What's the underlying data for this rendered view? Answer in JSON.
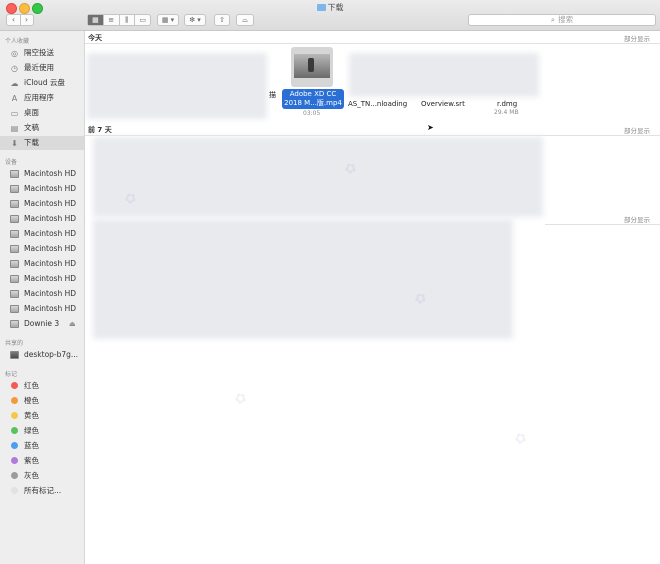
{
  "window": {
    "title": "下载"
  },
  "toolbar": {
    "back": "‹",
    "forward": "›",
    "view_buttons": [
      "▦",
      "≡",
      "⫼",
      "▭"
    ],
    "arrange": "▦ ▾",
    "action": "✻ ▾",
    "share": "⇧",
    "tag": "⌓",
    "search_placeholder": "搜索"
  },
  "sidebar": {
    "favorites_header": "个人收藏",
    "favorites": [
      {
        "label": "隔空投送",
        "icon": "airdrop-icon",
        "glyph": "◎"
      },
      {
        "label": "最近使用",
        "icon": "recents-icon",
        "glyph": "◷"
      },
      {
        "label": "iCloud 云盘",
        "icon": "cloud-icon",
        "glyph": "☁"
      },
      {
        "label": "应用程序",
        "icon": "applications-icon",
        "glyph": "A"
      },
      {
        "label": "桌面",
        "icon": "desktop-icon",
        "glyph": "▭"
      },
      {
        "label": "文稿",
        "icon": "documents-icon",
        "glyph": "▤"
      },
      {
        "label": "下载",
        "icon": "downloads-icon",
        "glyph": "⬇"
      }
    ],
    "devices_header": "设备",
    "devices": [
      {
        "label": "Macintosh HD"
      },
      {
        "label": "Macintosh HD"
      },
      {
        "label": "Macintosh HD"
      },
      {
        "label": "Macintosh HD"
      },
      {
        "label": "Macintosh HD"
      },
      {
        "label": "Macintosh HD"
      },
      {
        "label": "Macintosh HD"
      },
      {
        "label": "Macintosh HD"
      },
      {
        "label": "Macintosh HD"
      },
      {
        "label": "Macintosh HD"
      },
      {
        "label": "Downie 3"
      }
    ],
    "eject_glyph": "⏏",
    "shared_header": "共享的",
    "shared": [
      {
        "label": "desktop-b7g..."
      }
    ],
    "tags_header": "标记",
    "tags": [
      {
        "label": "红色",
        "color": "#f25c54"
      },
      {
        "label": "橙色",
        "color": "#f39a3c"
      },
      {
        "label": "黄色",
        "color": "#f4c84b"
      },
      {
        "label": "绿色",
        "color": "#5ac25c"
      },
      {
        "label": "蓝色",
        "color": "#4a9ff0"
      },
      {
        "label": "紫色",
        "color": "#b07ad8"
      },
      {
        "label": "灰色",
        "color": "#9b9b9b"
      },
      {
        "label": "所有标记...",
        "color": "#e2e2e2"
      }
    ]
  },
  "main": {
    "groups": [
      {
        "title": "今天",
        "show_part": "部分显示"
      },
      {
        "title": "前 7 天",
        "show_part": "部分显示"
      },
      {
        "title": "",
        "show_part": "部分显示"
      }
    ],
    "files": {
      "selected_name_line1": "Adobe XD CC",
      "selected_name_line2": "2018 M...版.mp4",
      "selected_duration": "03:05",
      "partial_left": "描",
      "file2": "AS_TN...nloading",
      "file3": "Overview.srt",
      "file4": "r.dmg",
      "file4_size": "29.4 MB"
    }
  }
}
